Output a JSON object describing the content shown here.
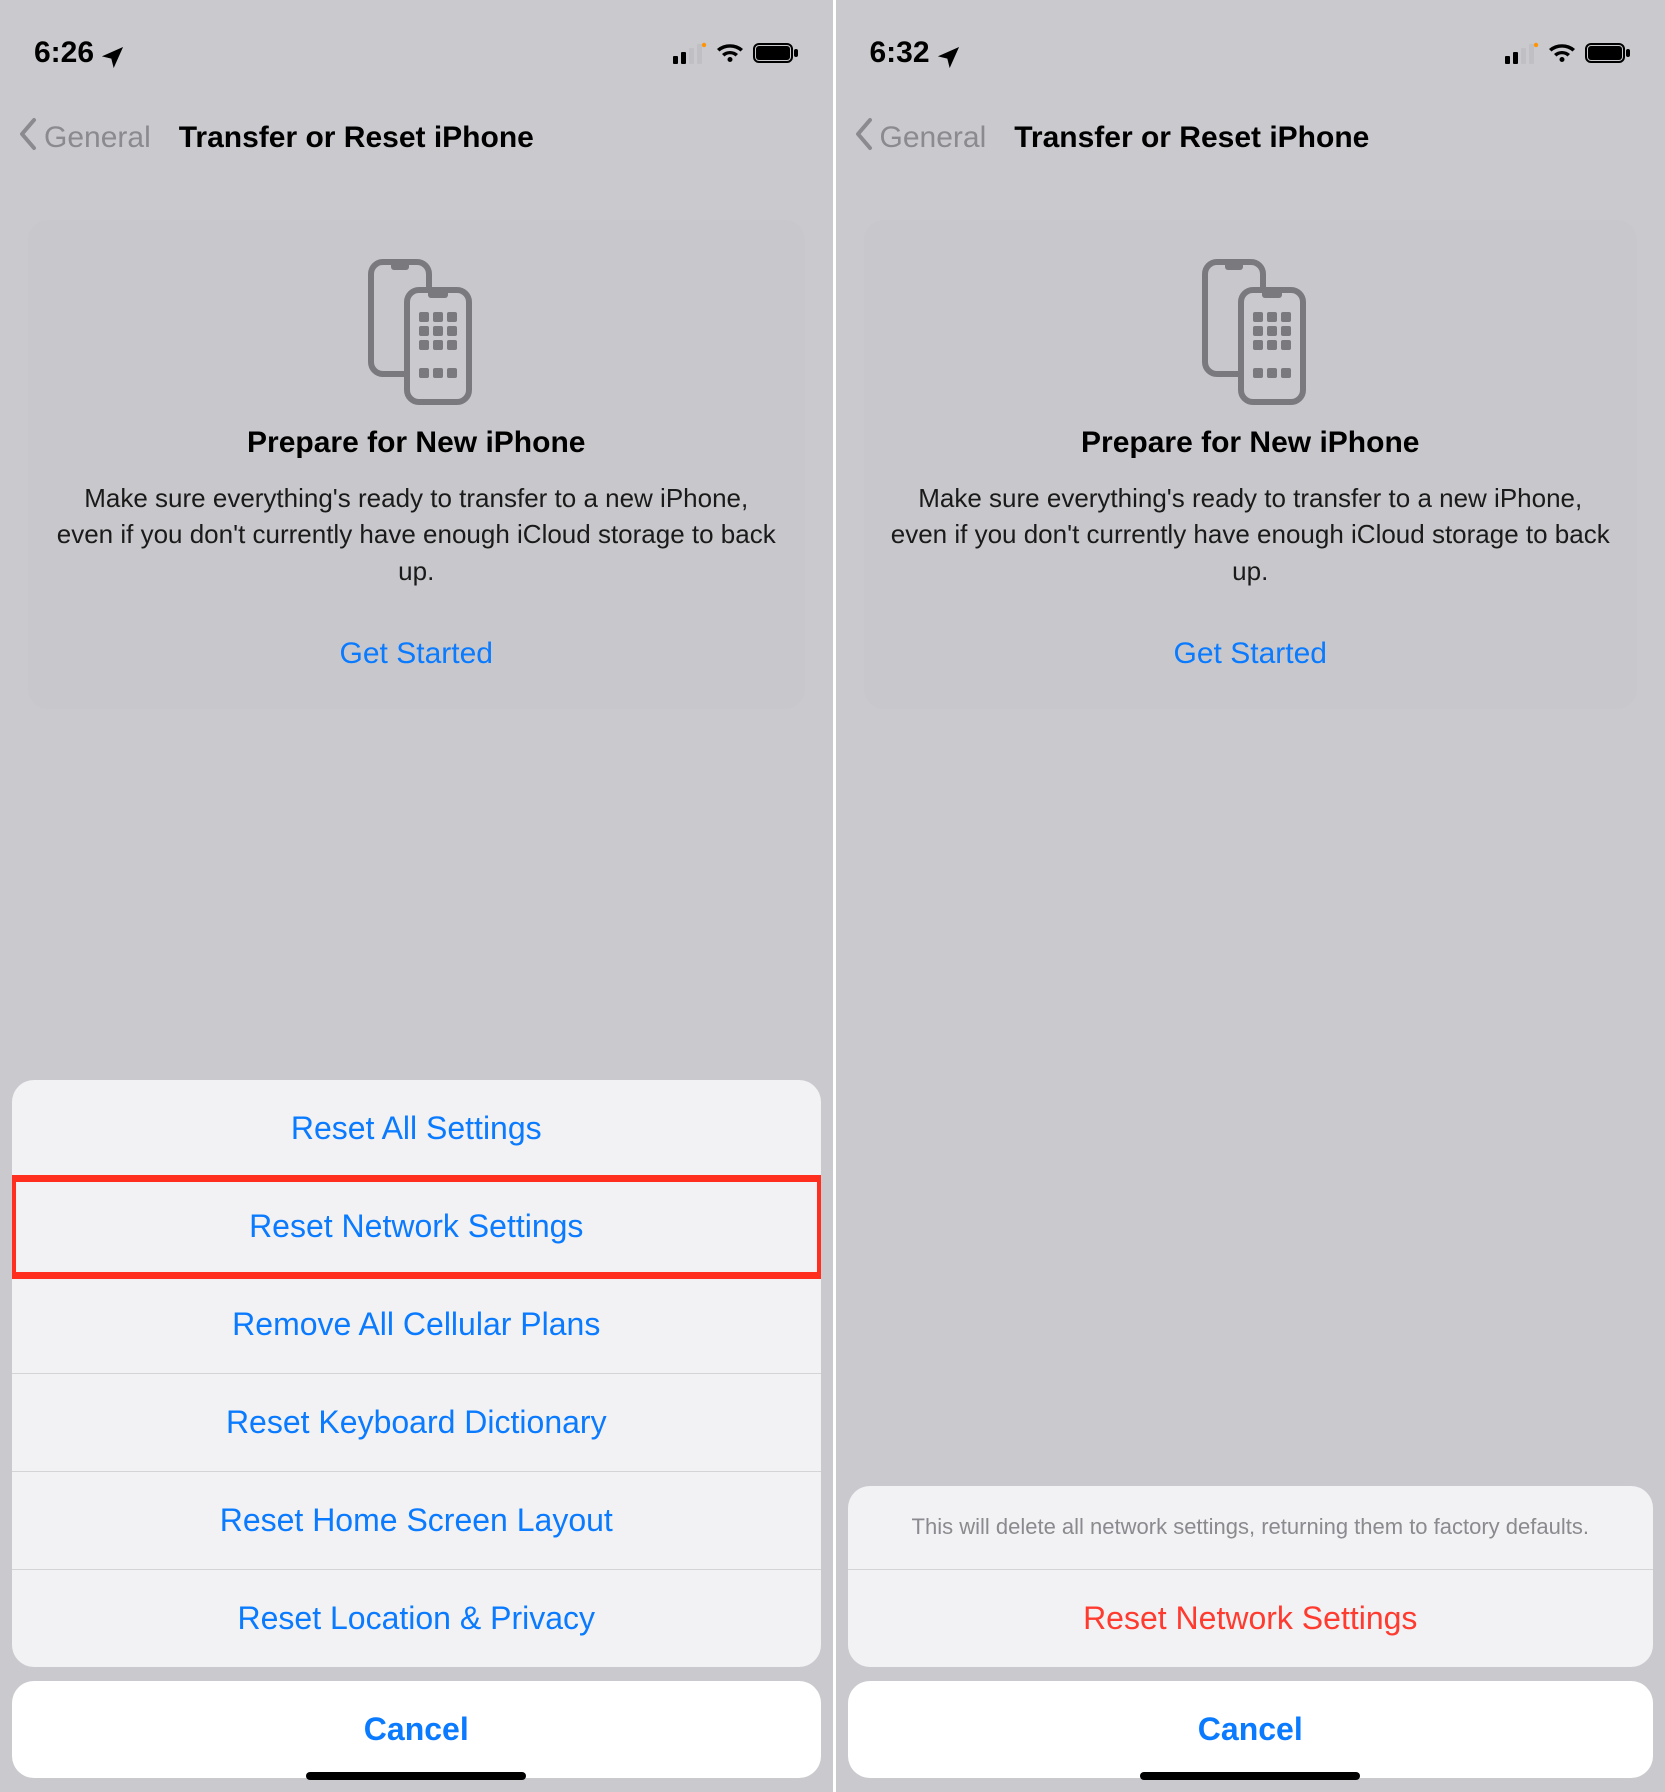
{
  "left": {
    "status": {
      "time": "6:26"
    },
    "nav": {
      "back": "General",
      "title": "Transfer or Reset iPhone"
    },
    "card": {
      "title": "Prepare for New iPhone",
      "desc": "Make sure everything's ready to transfer to a new iPhone, even if you don't currently have enough iCloud storage to back up.",
      "cta": "Get Started"
    },
    "sheet": {
      "items": [
        "Reset All Settings",
        "Reset Network Settings",
        "Remove All Cellular Plans",
        "Reset Keyboard Dictionary",
        "Reset Home Screen Layout",
        "Reset Location & Privacy"
      ],
      "highlighted_index": 1,
      "cancel": "Cancel"
    }
  },
  "right": {
    "status": {
      "time": "6:32"
    },
    "nav": {
      "back": "General",
      "title": "Transfer or Reset iPhone"
    },
    "card": {
      "title": "Prepare for New iPhone",
      "desc": "Make sure everything's ready to transfer to a new iPhone, even if you don't currently have enough iCloud storage to back up.",
      "cta": "Get Started"
    },
    "confirm": {
      "message": "This will delete all network settings, returning them to factory defaults.",
      "action": "Reset Network Settings",
      "cancel": "Cancel"
    }
  }
}
